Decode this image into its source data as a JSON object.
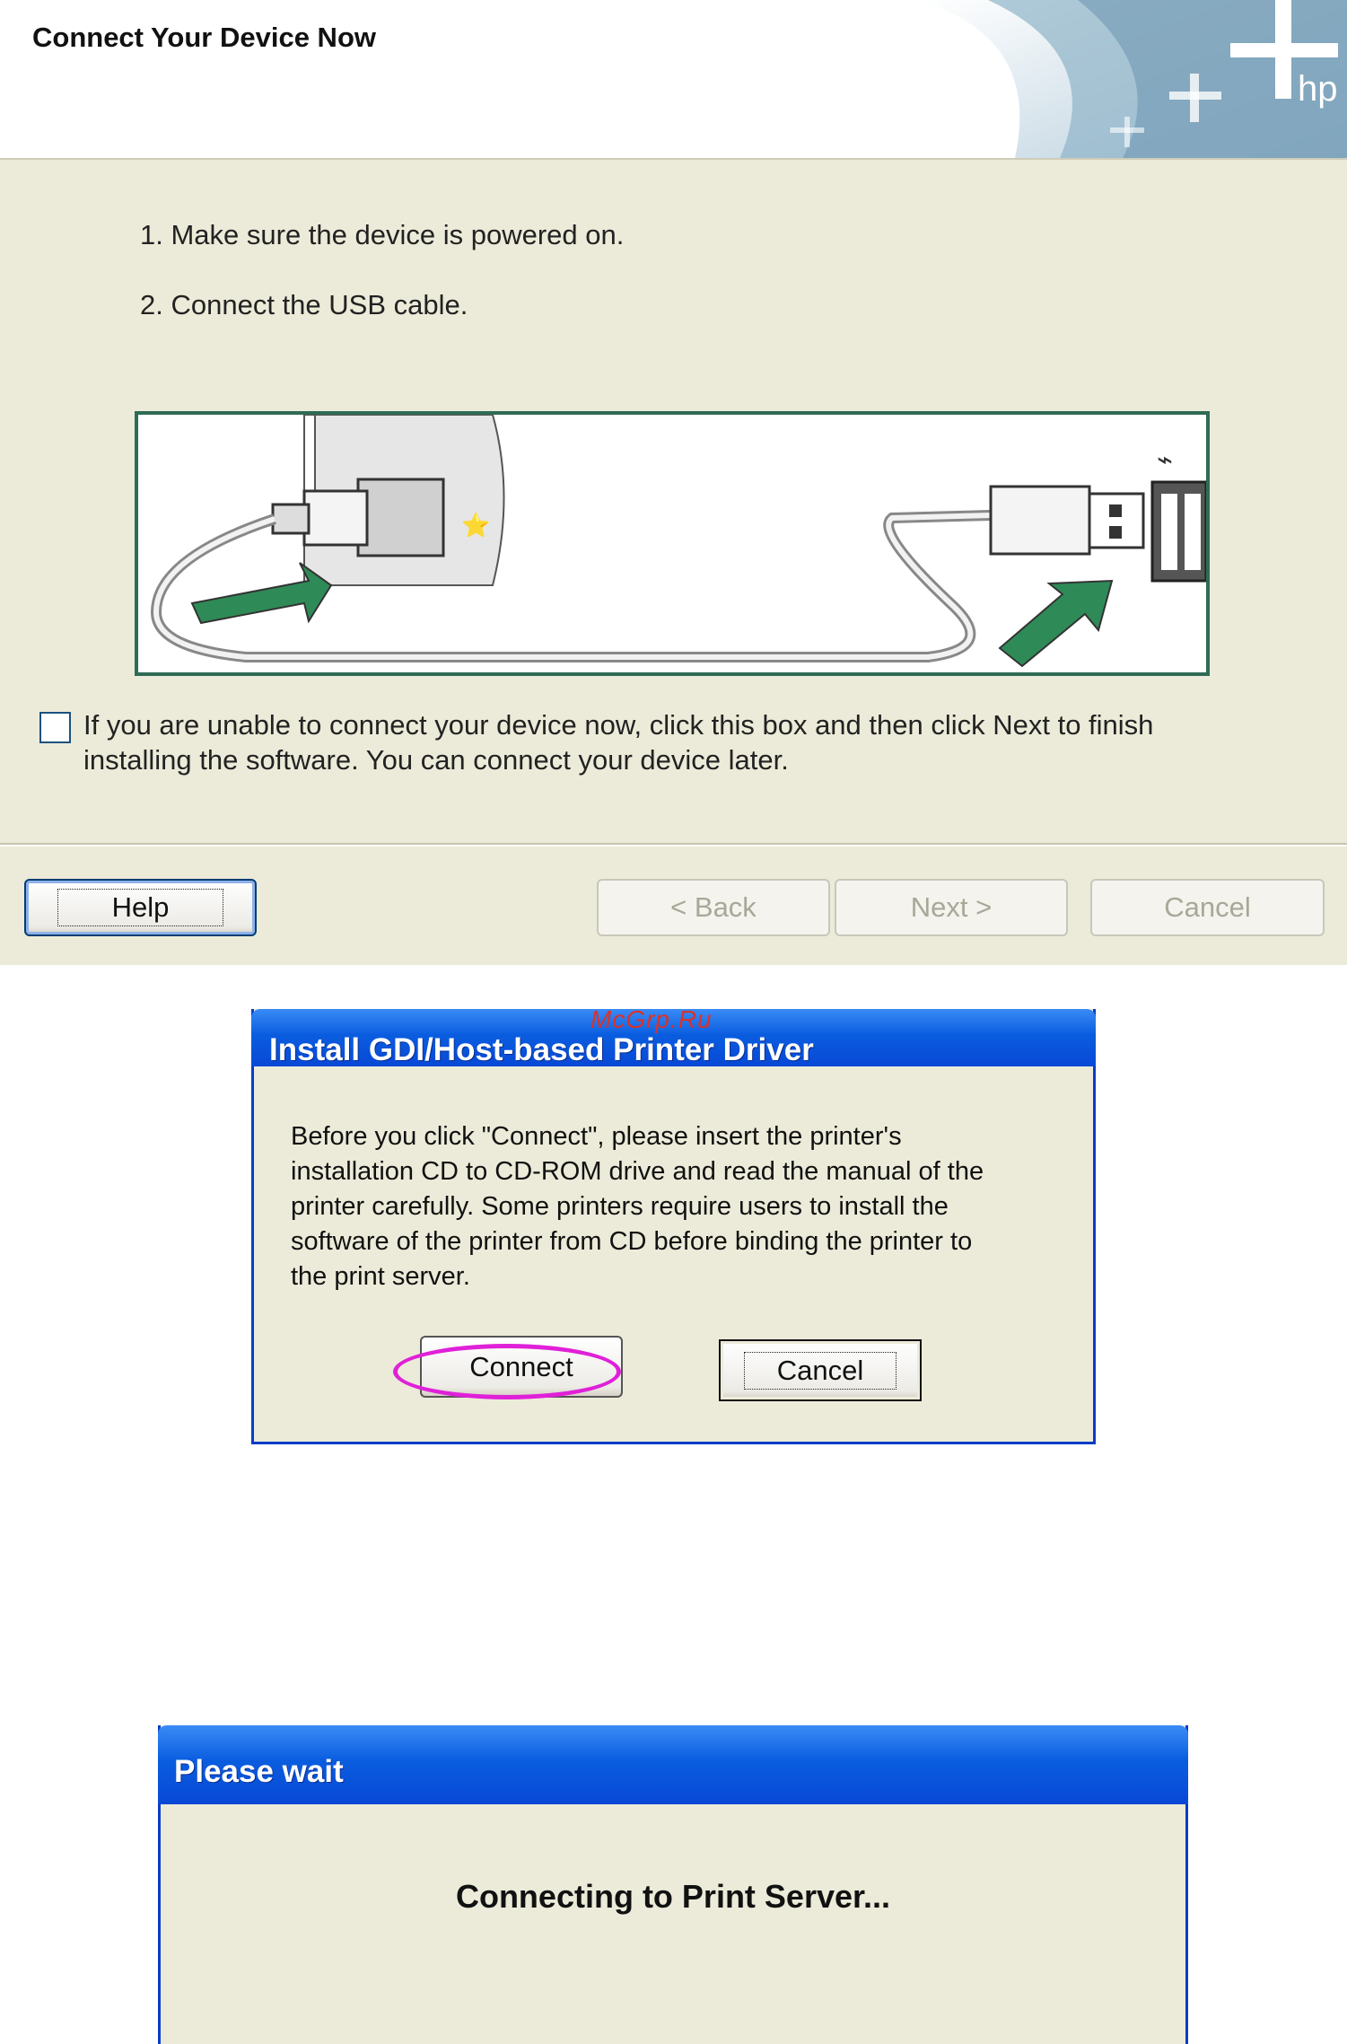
{
  "wizard": {
    "title": "Connect Your Device Now",
    "logo_text": "hp",
    "steps": [
      "1. Make sure the device is powered on.",
      "2. Connect the USB cable."
    ],
    "skip_checkbox_checked": false,
    "skip_text_line1": "If you are unable to connect your device now, click this box and then click Next to finish",
    "skip_text_line2": "installing the software. You can connect your device later.",
    "buttons": {
      "help": "Help",
      "back": "< Back",
      "next": "Next >",
      "cancel": "Cancel"
    }
  },
  "gdi_dialog": {
    "title": "Install GDI/Host-based Printer Driver",
    "watermark": "McGrp.Ru",
    "lines": [
      "Before you click \"Connect\", please insert the printer's",
      "installation CD to CD-ROM drive and read the manual of the",
      "printer carefully. Some printers require users to install the",
      "software of the printer from CD before binding the printer to",
      "the print server."
    ],
    "connect_label": "Connect",
    "cancel_label": "Cancel",
    "highlight_color": "#e020d8"
  },
  "wait_dialog": {
    "title": "Please wait",
    "message": "Connecting to Print Server..."
  },
  "colors": {
    "wizard_bg": "#ecebd9",
    "titlebar_blue": "#0a5ddf",
    "illustration_border": "#2e6b55"
  }
}
